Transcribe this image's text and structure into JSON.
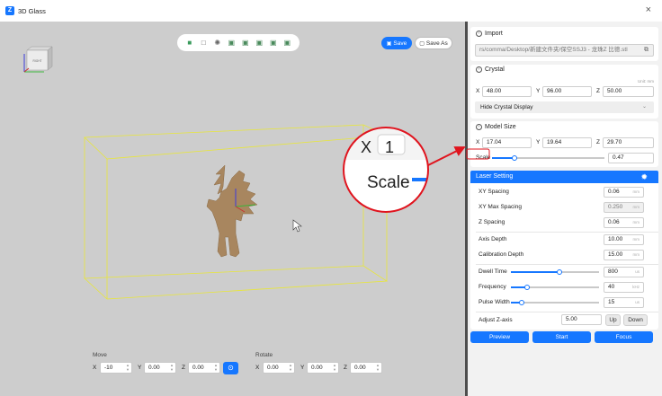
{
  "window": {
    "title": "3D Glass",
    "close_glyph": "×"
  },
  "toolbar": {
    "icons": [
      "cube-solid-icon",
      "cube-wire-icon",
      "sun-icon",
      "view-front-icon",
      "view-back-icon",
      "view-left-icon",
      "view-right-icon",
      "view-top-icon"
    ],
    "save_label": "Save",
    "save_as_label": "Save As"
  },
  "viewcube": {
    "face_label": "RIGHT"
  },
  "move": {
    "title": "Move",
    "x_label": "X",
    "x_value": "-10",
    "y_label": "Y",
    "y_value": "0.00",
    "z_label": "Z",
    "z_value": "0.00"
  },
  "rotate": {
    "title": "Rotate",
    "x_label": "X",
    "x_value": "0.00",
    "y_label": "Y",
    "y_value": "0.00",
    "z_label": "Z",
    "z_value": "0.00"
  },
  "import": {
    "title": "Import",
    "path": "rs/comma/Desktop/新建文件夹/保空SSJ3 - 龙珠Z 比德.stl"
  },
  "crystal": {
    "title": "Crystal",
    "unit": "Unit: mm",
    "x_label": "X",
    "x_value": "48.00",
    "y_label": "Y",
    "y_value": "96.00",
    "z_label": "Z",
    "z_value": "50.00",
    "hide_label": "Hide Crystal Display"
  },
  "model_size": {
    "title": "Model Size",
    "x_label": "X",
    "x_value": "17.04",
    "y_label": "Y",
    "y_value": "19.64",
    "z_label": "Z",
    "z_value": "29.70",
    "scale_label": "Scale",
    "scale_value": "0.47",
    "scale_fraction": 0.2
  },
  "laser": {
    "title": "Laser Setting",
    "xy_spacing_label": "XY Spacing",
    "xy_spacing_value": "0.06",
    "xy_spacing_unit": "mm",
    "xy_max_label": "XY Max Spacing",
    "xy_max_value": "0.250",
    "xy_max_unit": "mm",
    "z_spacing_label": "Z Spacing",
    "z_spacing_value": "0.06",
    "z_spacing_unit": "mm",
    "axis_depth_label": "Axis Depth",
    "axis_depth_value": "10.00",
    "axis_depth_unit": "mm",
    "calib_label": "Calibration Depth",
    "calib_value": "15.00",
    "calib_unit": "mm",
    "dwell_label": "Dwell Time",
    "dwell_value": "800",
    "dwell_unit": "us",
    "dwell_fraction": 0.55,
    "freq_label": "Frequency",
    "freq_value": "40",
    "freq_unit": "kHz",
    "freq_fraction": 0.18,
    "pulse_label": "Pulse Width",
    "pulse_value": "15",
    "pulse_unit": "us",
    "pulse_fraction": 0.12,
    "adjust_label": "Adjust Z-axis",
    "adjust_value": "5.00",
    "up_label": "Up",
    "down_label": "Down"
  },
  "actions": {
    "preview": "Preview",
    "start": "Start",
    "focus": "Focus"
  },
  "callout": {
    "text": "Scale"
  },
  "colors": {
    "accent": "#1677ff",
    "box_edge": "#e8e63a",
    "callout_ring": "#e0141e",
    "model": "#a8865f"
  }
}
